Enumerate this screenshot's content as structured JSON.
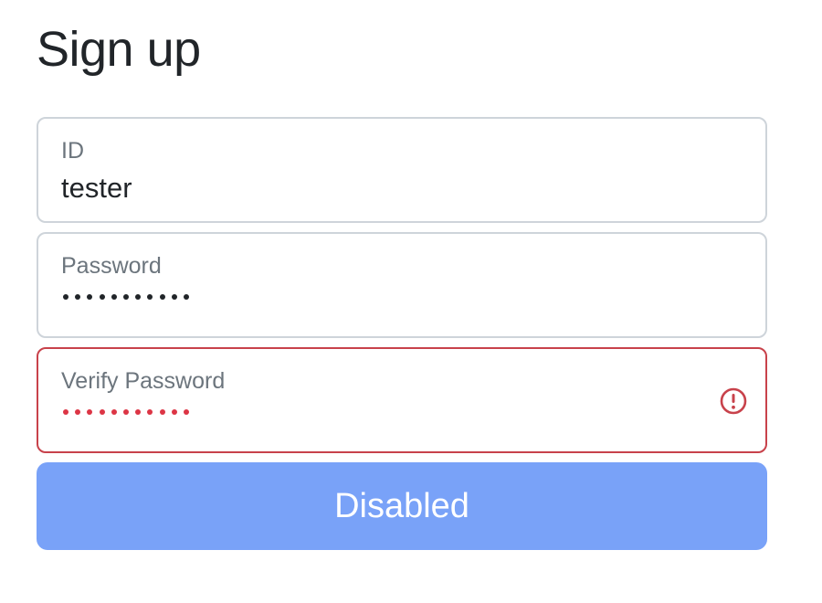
{
  "form": {
    "title": "Sign up",
    "fields": [
      {
        "label": "ID",
        "value": "tester",
        "type": "text",
        "invalid": false
      },
      {
        "label": "Password",
        "value": "•••••••••••",
        "type": "password",
        "masked_length": 11,
        "invalid": false
      },
      {
        "label": "Verify Password",
        "value": "•••••••••••",
        "type": "password",
        "masked_length": 11,
        "invalid": true,
        "status_icon": "error-exclamation-icon"
      }
    ],
    "submit_label": "Disabled",
    "submit_disabled": true
  },
  "colors": {
    "title_text": "#212529",
    "label_text": "#6c757d",
    "field_border": "#ced4da",
    "invalid_border": "#c8424b",
    "invalid_dots": "#dc3545",
    "button_bg": "#79a2f8",
    "button_text": "#ffffff"
  }
}
